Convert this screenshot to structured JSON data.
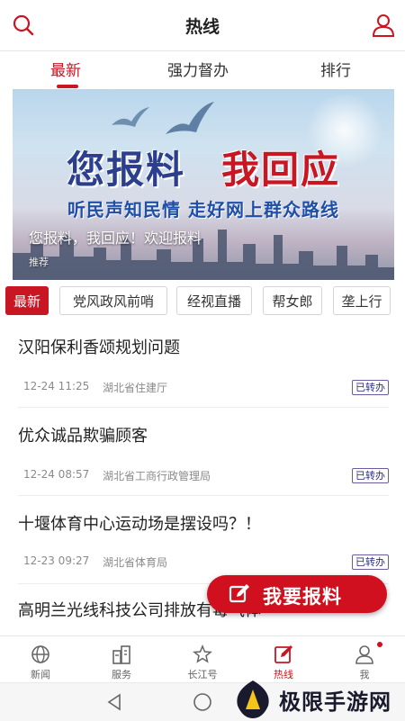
{
  "header": {
    "title": "热线",
    "left_icon": "search-icon",
    "right_icon": "user-icon"
  },
  "tabs": [
    {
      "label": "最新",
      "active": true
    },
    {
      "label": "强力督办",
      "active": false
    },
    {
      "label": "排行",
      "active": false
    }
  ],
  "banner": {
    "headline_part1": "您报料",
    "headline_part2": "我回应",
    "subline": "听民声知民情  走好网上群众路线",
    "caption": "您报料，我回应！欢迎报料",
    "tag": "推荐"
  },
  "categories": [
    {
      "label": "最新",
      "active": true
    },
    {
      "label": "党风政风前哨",
      "active": false
    },
    {
      "label": "经视直播",
      "active": false
    },
    {
      "label": "帮女郎",
      "active": false
    },
    {
      "label": "垄上行",
      "active": false
    }
  ],
  "news": [
    {
      "title": "汉阳保利香颂规划问题",
      "time": "12-24 11:25",
      "department": "湖北省住建厅",
      "status": "已转办"
    },
    {
      "title": "优众诚品欺骗顾客",
      "time": "12-24 08:57",
      "department": "湖北省工商行政管理局",
      "status": "已转办"
    },
    {
      "title": "十堰体育中心运动场是摆设吗？！",
      "time": "12-23 09:27",
      "department": "湖北省体育局",
      "status": "已转办"
    },
    {
      "title": "高明兰光线科技公司排放有毒气体",
      "time": "",
      "department": "",
      "status": ""
    }
  ],
  "report_button": {
    "label": "我要报料",
    "icon": "edit-icon"
  },
  "bottom_nav": [
    {
      "label": "新闻",
      "icon": "globe-icon",
      "active": false
    },
    {
      "label": "服务",
      "icon": "buildings-icon",
      "active": false
    },
    {
      "label": "长江号",
      "icon": "star-icon",
      "active": false
    },
    {
      "label": "热线",
      "icon": "edit-icon",
      "active": true
    },
    {
      "label": "我",
      "icon": "user-icon",
      "active": false,
      "badge": true
    }
  ],
  "watermark": {
    "text": "极限手游网"
  },
  "colors": {
    "accent": "#c81623",
    "badge_border": "#6e5aa0",
    "meta_text": "#8a8a8a"
  }
}
